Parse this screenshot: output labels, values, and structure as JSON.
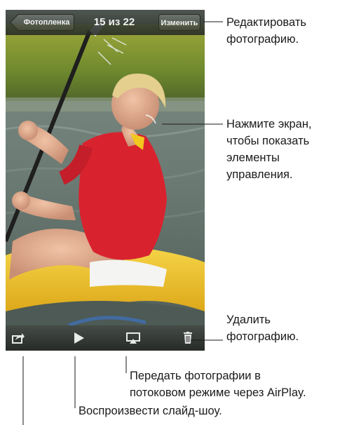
{
  "nav": {
    "back_label": "Фотопленка",
    "counter": "15 из 22",
    "edit_label": "Изменить"
  },
  "toolbar": {
    "icons": [
      "share-icon",
      "play-icon",
      "airplay-icon",
      "trash-icon"
    ]
  },
  "callouts": {
    "edit": "Редактировать\nфотографию.",
    "tap": "Нажмите экран,\nчтобы показать\nэлементы\nуправления.",
    "delete": "Удалить\nфотографию.",
    "airplay": "Передать фотографии в\nпотоковом режиме через AirPlay.",
    "slideshow": "Воспроизвести слайд-шоу."
  },
  "colors": {
    "bar": "#2a2e2a",
    "kayak": "#f2c81e",
    "shirt": "#d8232f"
  }
}
